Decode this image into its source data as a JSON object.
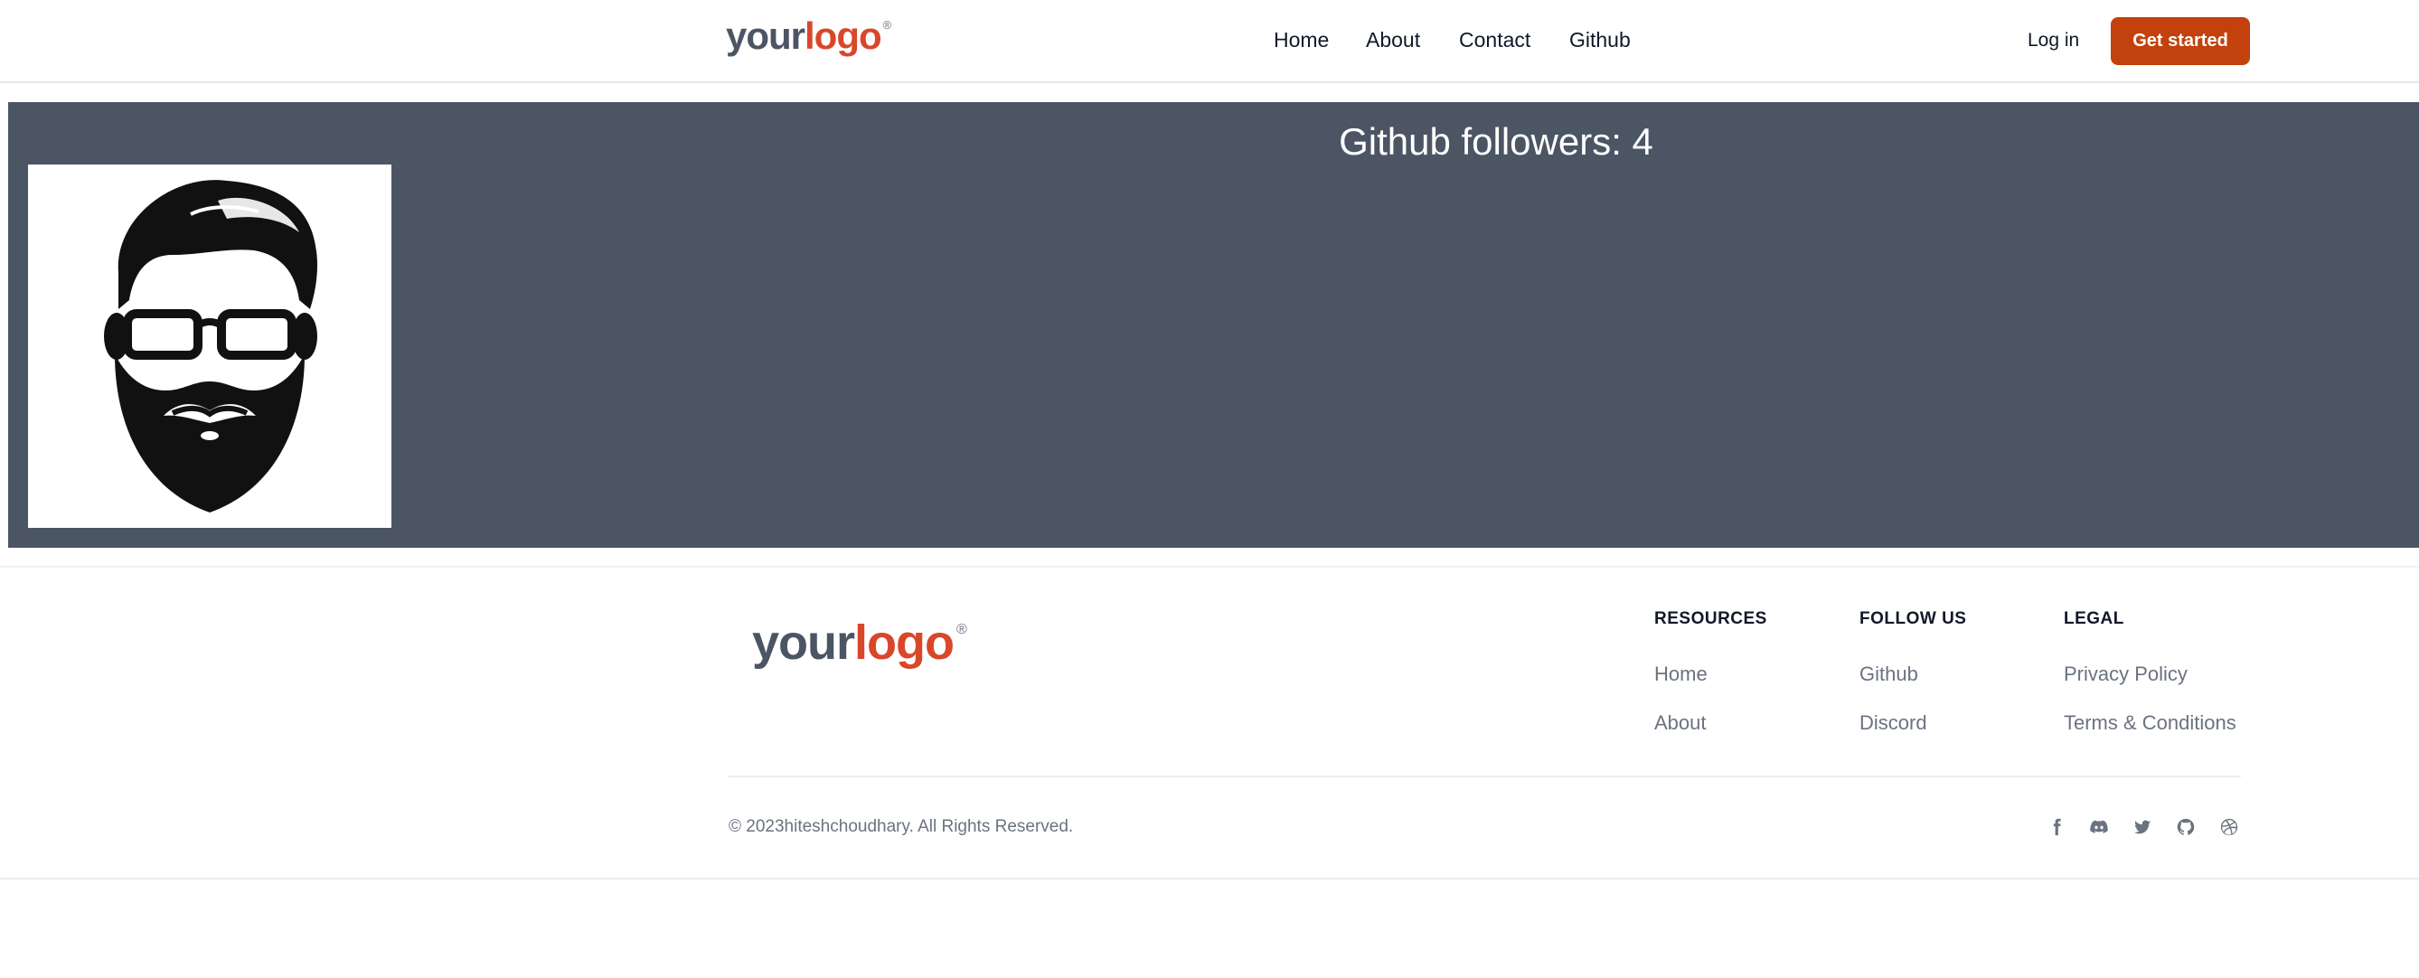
{
  "header": {
    "logo": {
      "word1": "your",
      "word2": "logo",
      "mark": "®"
    },
    "nav": [
      {
        "label": "Home"
      },
      {
        "label": "About"
      },
      {
        "label": "Contact"
      },
      {
        "label": "Github"
      }
    ],
    "login_label": "Log in",
    "cta_label": "Get started",
    "cta_color": "#c2410c"
  },
  "main": {
    "followers_text": "Github followers: 4",
    "background_color": "#4b5563",
    "avatar_icon": "bearded-man-with-glasses-icon"
  },
  "footer": {
    "logo": {
      "word1": "your",
      "word2": "logo",
      "mark": "®"
    },
    "columns": [
      {
        "heading": "RESOURCES",
        "links": [
          "Home",
          "About"
        ]
      },
      {
        "heading": "FOLLOW US",
        "links": [
          "Github",
          "Discord"
        ]
      },
      {
        "heading": "LEGAL",
        "links": [
          "Privacy Policy",
          "Terms & Conditions"
        ]
      }
    ],
    "copyright": "© 2023hiteshchoudhary. All Rights Reserved.",
    "social_icons": [
      "facebook-icon",
      "discord-icon",
      "twitter-icon",
      "github-icon",
      "dribbble-icon"
    ]
  }
}
